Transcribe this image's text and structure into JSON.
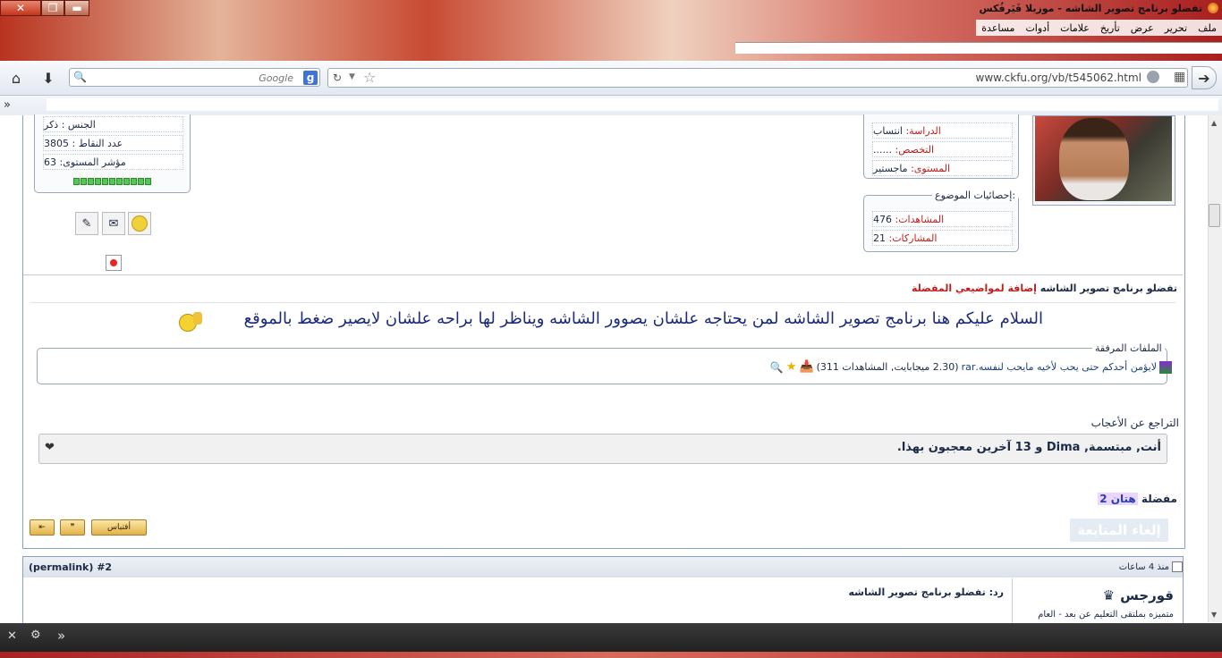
{
  "window": {
    "title": "تفضلو برنامج تصوير الشاشه - موزيلا فَيَرفُكس",
    "buttons": {
      "close": "✕",
      "max": "❐",
      "min": "▬"
    }
  },
  "menu": [
    "ملف",
    "تحرير",
    "عرض",
    "تأريخ",
    "علامات",
    "أدوات",
    "مساعدة"
  ],
  "toolbar": {
    "search_placeholder": "Google",
    "url": "www.ckfu.org/vb/t545062.html",
    "overflow": "»"
  },
  "profile": {
    "fields": [
      {
        "key": "الدراسة:",
        "value": "انتساب"
      },
      {
        "key": "التخصص:",
        "value": "......"
      },
      {
        "key": "المستوى:",
        "value": "ماجستير"
      }
    ],
    "stats_legend": "إحصائيات الموضوع:",
    "stats": [
      {
        "key": "المشاهدات:",
        "value": "476"
      },
      {
        "key": "المشاركات:",
        "value": "21"
      }
    ],
    "left_fields": [
      "الجنس : ذكر",
      "عدد النقاط : 3805",
      "مؤشر المستوى: 63"
    ],
    "level_bars": 11
  },
  "post": {
    "subject": "تفضلو برنامج تصوير الشاشه",
    "add_fav": "إضافة لمواضيعي المفضلة",
    "body": "السلام عليكم هنا برنامج تصوير الشاشه لمن يحتاجه علشان يصوور الشاشه ويناظر لها براحه علشان لايصير ضغط بالموقع",
    "attach_legend": "الملفات المرفقة",
    "attach_name": "لايؤمن أحدكم حتى يحب لأخيه مايحب لنفسه.rar",
    "attach_info": "(2.30 ميجابايت, المشاهدات 311)",
    "likes_legend": "التراجع عن الأعجاب",
    "likes_text": "أنت, مبتسمة, Dima و 13 آخرين معجبون بهذا.",
    "fav_label": "مفضلة",
    "fav_value": "هتان 2",
    "quote_button": "أقتباس",
    "unfollow": "إلغاء المتابعة"
  },
  "post2": {
    "time": "منذ 4 ساعات",
    "permalink": "(permalink) #2",
    "reply_title": "رد: تفضلو برنامج تصوير الشاشه",
    "author": "قورجس",
    "author_sub": "متميزه بملتقى التعليم عن بعد - العام"
  },
  "taskbar": {
    "close": "✕",
    "tools": "🔧",
    "more": "»"
  },
  "colors": {
    "accent": "#1b2a45",
    "red": "#c11c1c",
    "link": "#1a3f7a",
    "green": "#54c654"
  }
}
